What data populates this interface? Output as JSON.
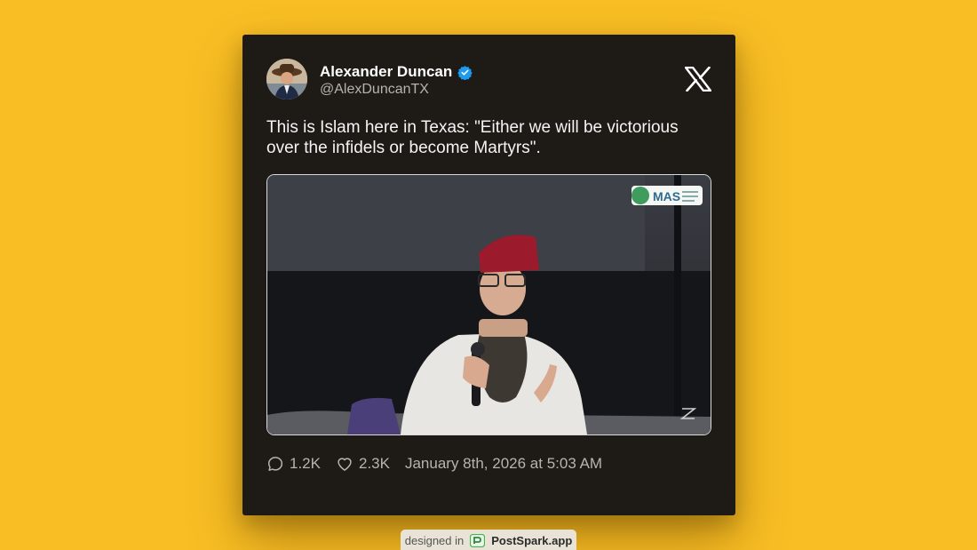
{
  "tweet": {
    "author_name": "Alexander Duncan",
    "handle": "@AlexDuncanTX",
    "verified_icon": "verified-badge-icon",
    "brand_icon": "x-logo-icon",
    "text": "This is Islam here in Texas: \"Either we will be victorious over the infidels or become Martyrs\".",
    "media": {
      "watermark": "MAS"
    },
    "stats": {
      "replies": "1.2K",
      "likes": "2.3K"
    },
    "timestamp": "January 8th, 2026 at 5:03 AM"
  },
  "footer_badge": {
    "prefix": "designed in",
    "brand": "PostSpark.app"
  },
  "colors": {
    "background": "#F9BE24",
    "card": "#1e1b17",
    "verified": "#1D9BF0"
  }
}
